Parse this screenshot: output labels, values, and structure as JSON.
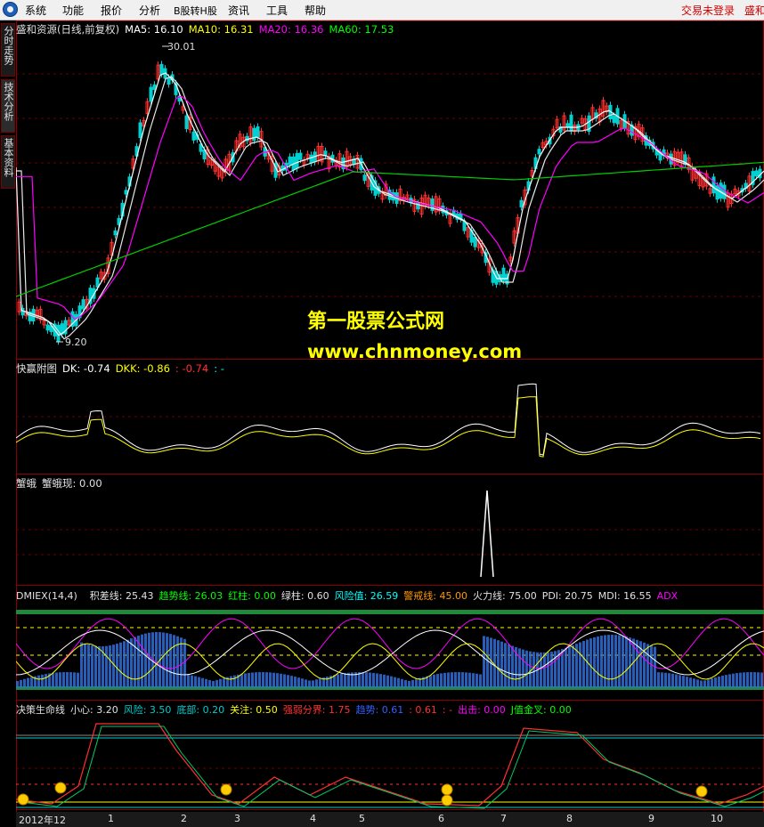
{
  "menu": {
    "items": [
      "系统",
      "功能",
      "报价",
      "分析",
      "B股转H股",
      "资讯",
      "工具",
      "帮助"
    ],
    "login_status": "交易未登录",
    "account_fragment": "盛和"
  },
  "side_tabs": [
    "分时走势",
    "技术分析",
    "基本资料"
  ],
  "panel_main": {
    "title": "盛和资源(日线,前复权)",
    "ma5": "MA5: 16.10",
    "ma10": "MA10: 16.31",
    "ma20": "MA20: 16.36",
    "ma60": "MA60: 17.53",
    "high_label": "30.01",
    "low_label": "9.20",
    "colors": {
      "up": "#ff3030",
      "down": "#00d0d0",
      "ma5": "#ffffff",
      "ma10": "#ffff00",
      "ma20": "#ff00ff",
      "ma60": "#00cc00"
    }
  },
  "watermark": {
    "line1": "第一股票公式网",
    "line2": "www.chnmoney.com"
  },
  "panel_kuaiying": {
    "title": "快赢附图",
    "dk": "DK: -0.74",
    "dkk": "DKK: -0.86",
    "extra1": ": -0.74",
    "extra2": ": -"
  },
  "panel_crab": {
    "title": "蟹蛾",
    "value": "蟹蛾现: 0.00"
  },
  "panel_dmiex": {
    "title": "DMIEX(14,4)",
    "jicha": "积差线: 25.43",
    "qushi": "趋势线: 26.03",
    "hongzhu": "红柱: 0.00",
    "lvzhu": "绿柱: 0.60",
    "fengxian": "风险值: 26.59",
    "jingjie": "警戒线: 45.00",
    "huoli": "火力线: 75.00",
    "pdi": "PDI: 20.75",
    "mdi": "MDI: 16.55",
    "adx": "ADX"
  },
  "panel_juece": {
    "title": "决策生命线",
    "xiaoxin": "小心: 3.20",
    "fengxian": "风险: 3.50",
    "dibu": "底部: 0.20",
    "guanzhu": "关注: 0.50",
    "qiangruo": "强弱分界: 1.75",
    "qushi": "趋势: 0.61",
    "x1": ": 0.61",
    "x2": ": -",
    "chuji": "出击: 0.00",
    "jzhi": "J值金叉: 0.00"
  },
  "x_axis": {
    "labels": [
      "2012年12",
      "1",
      "2",
      "3",
      "4",
      "5",
      "6",
      "7",
      "8",
      "9",
      "10"
    ]
  }
}
